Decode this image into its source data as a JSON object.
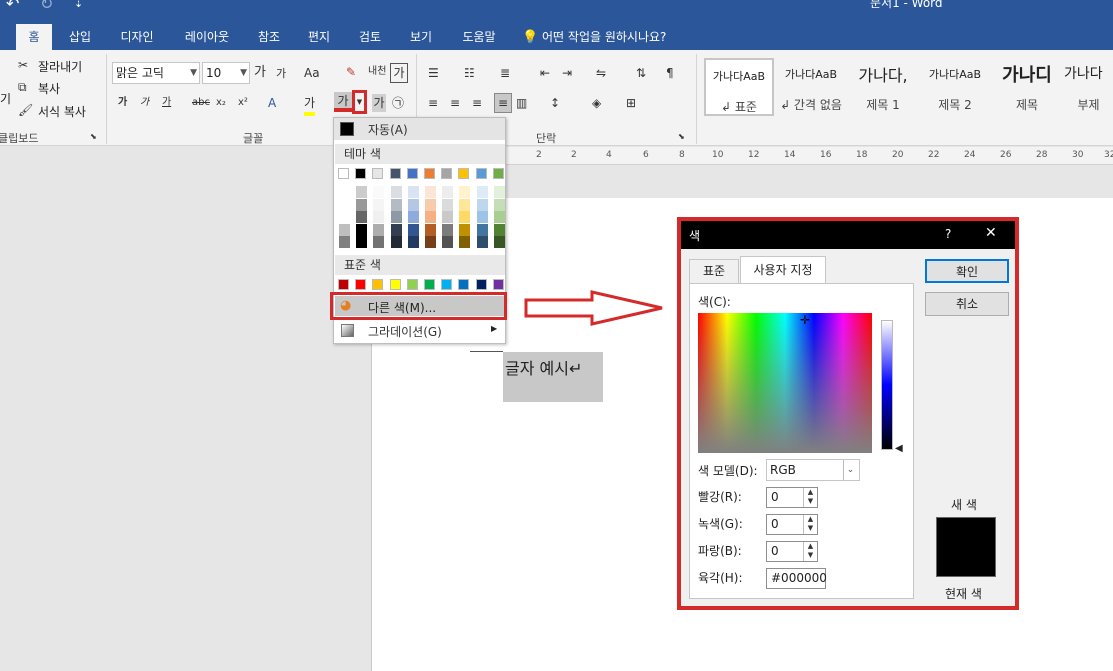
{
  "titlebar": {
    "doc_title": "문서1  -  Word",
    "undo": "↶",
    "redo": "↻",
    "customize": "⇣"
  },
  "tabs": [
    "홈",
    "삽입",
    "디자인",
    "레이아웃",
    "참조",
    "편지",
    "검토",
    "보기",
    "도움말"
  ],
  "tell_me": "어떤 작업을 원하시나요?",
  "clipboard": {
    "cut": "잘라내기",
    "copy": "복사",
    "format_painter": "서식 복사",
    "paste_partial": "기",
    "group": "클립보드"
  },
  "font": {
    "name": "맑은 고딕",
    "size": "10",
    "grow": "가",
    "shrink": "가",
    "case": "Aa",
    "bold": "가",
    "italic": "가",
    "underline": "가",
    "strike": "abc",
    "subscript": "x₂",
    "superscript": "x²",
    "phonetic": "내천",
    "border_char": "가",
    "font_color": "가",
    "shade": "가",
    "enclose": "㉠",
    "group": "글꼴"
  },
  "paragraph": {
    "group": "단락"
  },
  "styles": [
    {
      "preview": "가나다AaB",
      "label": "↲ 표준"
    },
    {
      "preview": "가나다AaB",
      "label": "↲ 간격 없음"
    },
    {
      "preview": "가나다,",
      "label": "제목 1"
    },
    {
      "preview": "가나다AaB",
      "label": "제목 2"
    },
    {
      "preview": "가나디",
      "label": "제목"
    },
    {
      "preview": "가나다",
      "label": "부제"
    }
  ],
  "ruler": [
    "2",
    "2",
    "4",
    "6",
    "8",
    "10",
    "12",
    "14",
    "16",
    "18",
    "20",
    "22",
    "24",
    "26",
    "28",
    "30",
    "32"
  ],
  "document": {
    "sample_text": "글자  예시↵"
  },
  "dropdown": {
    "auto": "자동(A)",
    "theme_header": "테마 색",
    "standard_header": "표준 색",
    "more_colors": "다른 색(M)...",
    "gradient": "그라데이션(G)",
    "theme_colors": [
      "#ffffff",
      "#000000",
      "#e7e6e6",
      "#44546a",
      "#4472c4",
      "#ed7d31",
      "#a5a5a5",
      "#ffc000",
      "#5b9bd5",
      "#70ad47"
    ],
    "standard_colors": [
      "#c00000",
      "#ff0000",
      "#ffc000",
      "#ffff00",
      "#92d050",
      "#00b050",
      "#00b0f0",
      "#0070c0",
      "#002060",
      "#7030a0"
    ]
  },
  "dialog": {
    "title": "색",
    "help": "?",
    "close": "✕",
    "tab_standard": "표준",
    "tab_custom": "사용자 지정",
    "colors_label": "색(C):",
    "model_label": "색 모델(D):",
    "model_value": "RGB",
    "red_label": "빨강(R):",
    "green_label": "녹색(G):",
    "blue_label": "파랑(B):",
    "hex_label": "육각(H):",
    "red": "0",
    "green": "0",
    "blue": "0",
    "hex": "#000000",
    "ok": "확인",
    "cancel": "취소",
    "new_color": "새 색",
    "current_color": "현재 색",
    "accent": "#d42a2a"
  }
}
